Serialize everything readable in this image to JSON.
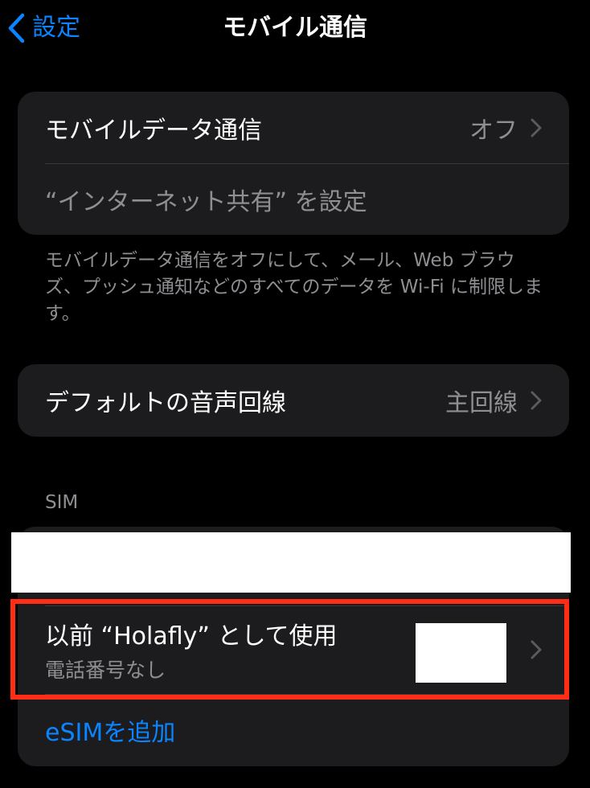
{
  "nav": {
    "back_label": "設定",
    "title": "モバイル通信"
  },
  "mobile_data_card": {
    "items": [
      {
        "label": "モバイルデータ通信",
        "value": "オフ"
      },
      {
        "label": "“インターネット共有” を設定"
      }
    ]
  },
  "mobile_data_footer": "モバイルデータ通信をオフにして、メール、Web ブラウズ、プッシュ通知などのすべてのデータを Wi‑Fi に制限します。",
  "default_voice": {
    "label": "デフォルトの音声回線",
    "value": "主回線"
  },
  "sim_section": {
    "header": "SIM",
    "previous_line": {
      "label": "以前 “Holafly” として使用",
      "sublabel": "電話番号なし"
    },
    "add_esim_label": "eSIMを追加"
  },
  "colors": {
    "background": "#000000",
    "card": "#1c1c1e",
    "accent_blue": "#0a84ff",
    "secondary_text": "#8e8e93",
    "highlight_red": "#ff2d16",
    "redaction": "#ffffff"
  },
  "icons": {
    "back": "chevron-left-icon",
    "disclosure": "chevron-right-icon"
  }
}
